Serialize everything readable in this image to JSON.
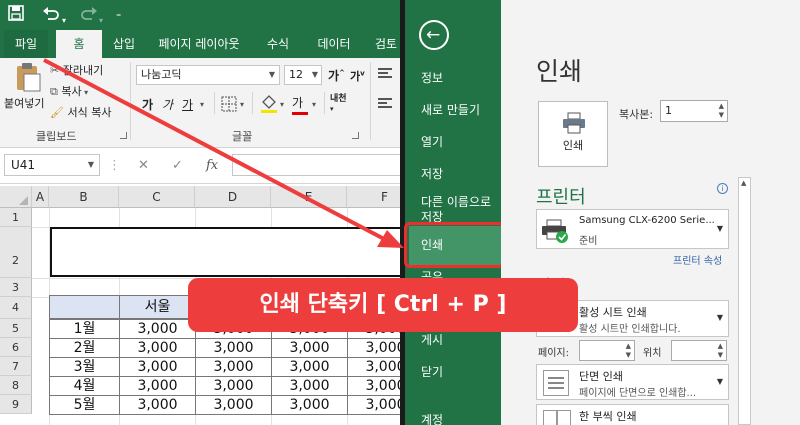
{
  "excel": {
    "qat": {
      "save_icon": "save-icon",
      "undo_icon": "undo-icon",
      "redo_icon": "redo-icon"
    },
    "tabs": [
      "파일",
      "홈",
      "삽입",
      "페이지 레이아웃",
      "수식",
      "데이터",
      "검토"
    ],
    "ribbon": {
      "paste_label": "붙여넣기",
      "cut_label": "잘라내기",
      "copy_label": "복사",
      "format_painter_label": "서식 복사",
      "clipboard_group": "클립보드",
      "font_name": "나눔고딕",
      "font_size": "12",
      "bold": "가",
      "italic": "가",
      "underline": "가",
      "font_color_glyph": "가",
      "phonetic_label": "내천",
      "grow_glyph": "가",
      "shrink_glyph": "가",
      "font_group": "글꼴"
    },
    "formula_bar": {
      "name_box": "U41",
      "fx": "fx"
    },
    "columns": [
      "A",
      "B",
      "C",
      "D",
      "E",
      "F"
    ],
    "rows": [
      "1",
      "2",
      "3",
      "4",
      "5",
      "6",
      "7",
      "8",
      "9"
    ],
    "table": {
      "header": [
        "서울"
      ],
      "months": [
        "1월",
        "2월",
        "3월",
        "4월",
        "5월"
      ],
      "values": [
        [
          "3,000",
          "3,000",
          "3,000",
          "3,000",
          "3,0"
        ],
        [
          "3,000",
          "3,000",
          "3,000",
          "3,000",
          "3,0"
        ],
        [
          "3,000",
          "3,000",
          "3,000",
          "3,000",
          "3,0"
        ],
        [
          "3,000",
          "3,000",
          "3,000",
          "3,000",
          "3,0"
        ],
        [
          "3,000",
          "3,000",
          "3,000",
          "3,000",
          "3,0"
        ]
      ]
    }
  },
  "backstage": {
    "nav": [
      "정보",
      "새로 만들기",
      "열기",
      "저장",
      "다른 이름으로 저장",
      "인쇄",
      "공유",
      "게시",
      "닫기",
      "계정"
    ],
    "title": "인쇄",
    "print_button": "인쇄",
    "copies_label": "복사본:",
    "copies_value": "1",
    "printer_header": "프린터",
    "printer_name": "Samsung CLX-6200 Serie...",
    "printer_status": "준비",
    "printer_props": "프린터 속성",
    "settings_header": "설정",
    "active_sheet": {
      "title": "활성 시트 인쇄",
      "desc": "활성 시트만 인쇄합니다."
    },
    "pages_label": "페이지:",
    "to_label": "위치",
    "one_sided": {
      "title": "단면 인쇄",
      "desc": "페이지에 단면으로 인쇄합..."
    },
    "collated": {
      "title": "한 부씩 인쇄"
    }
  },
  "callout": {
    "text": "인쇄 단축키 [ Ctrl + P ]"
  },
  "colors": {
    "excel_green": "#217346",
    "highlight_red": "#ee3d3d"
  }
}
